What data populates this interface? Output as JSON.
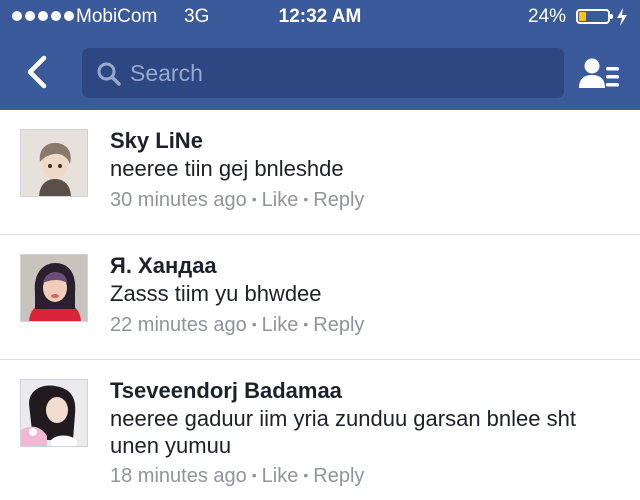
{
  "status_bar": {
    "carrier": "MobiCom",
    "network": "3G",
    "time": "12:32 AM",
    "battery_percent": "24%",
    "battery_level": 0.24,
    "signal_bars": 5
  },
  "nav": {
    "search_placeholder": "Search",
    "icons": [
      "back-chevron-icon",
      "search-icon",
      "friends-list-icon"
    ]
  },
  "comments": [
    {
      "author": "Sky LiNe",
      "text": "neeree tiin gej bnleshde",
      "time": "30 minutes ago",
      "like_label": "Like",
      "reply_label": "Reply"
    },
    {
      "author": "Я. Хандаа",
      "text": "Zasss tiim yu bhwdee",
      "time": "22 minutes ago",
      "like_label": "Like",
      "reply_label": "Reply"
    },
    {
      "author": "Tseveendorj Badamaa",
      "text": "neeree gaduur iim yria zunduu garsan bnlee sht unen yumuu",
      "time": "18 minutes ago",
      "like_label": "Like",
      "reply_label": "Reply"
    }
  ],
  "colors": {
    "header": "#3b5a99",
    "search_field": "#2d4782",
    "meta_text": "#90949c",
    "battery": "#f5c518"
  }
}
